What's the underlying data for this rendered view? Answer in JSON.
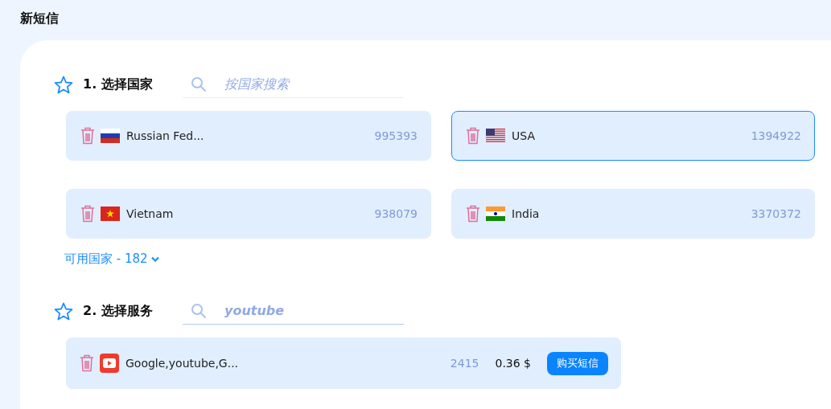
{
  "page_title": "新短信",
  "country_section": {
    "title": "1. 选择国家",
    "search": {
      "placeholder": "按国家搜索"
    },
    "countries": [
      {
        "name": "Russian Fed...",
        "count": "995393",
        "kind": "ru",
        "selected": false
      },
      {
        "name": "USA",
        "count": "1394922",
        "kind": "us",
        "selected": true
      },
      {
        "name": "Vietnam",
        "count": "938079",
        "kind": "vn",
        "selected": false
      },
      {
        "name": "India",
        "count": "3370372",
        "kind": "in",
        "selected": false
      }
    ],
    "available_link": "可用国家 - 182"
  },
  "service_section": {
    "title": "2. 选择服务",
    "search": {
      "value": "youtube"
    },
    "services": [
      {
        "name": "Google,youtube,G...",
        "count": "2415",
        "price": "0.36 $",
        "button": "购买短信"
      }
    ]
  }
}
